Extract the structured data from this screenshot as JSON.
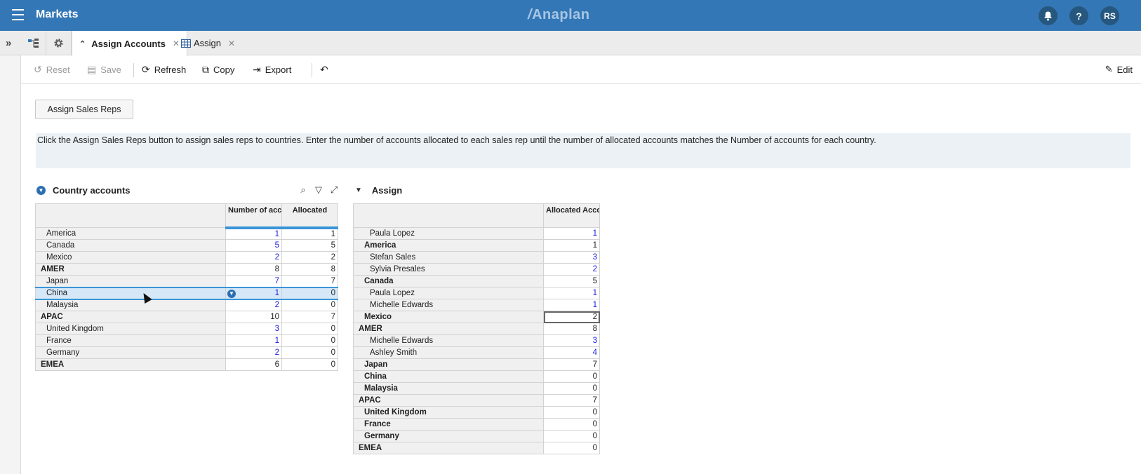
{
  "header": {
    "app_title": "Markets",
    "brand": "Anaplan",
    "notifications_icon": "bell-icon",
    "help_label": "?",
    "avatar_initials": "RS",
    "colors": {
      "bar": "#3477b6",
      "icon_bg": "#26577f",
      "accent": "#3a94d8",
      "input_blue": "#1a1ae0"
    }
  },
  "tabs": [
    {
      "label": "Assign Accounts",
      "active": true
    },
    {
      "label": "Assign",
      "active": false
    }
  ],
  "toolbar": {
    "reset": "Reset",
    "save": "Save",
    "refresh": "Refresh",
    "copy": "Copy",
    "export": "Export",
    "edit": "Edit"
  },
  "action_button": "Assign Sales Reps",
  "info_text": "Click the Assign Sales Reps button to assign sales reps to countries. Enter the number of accounts allocated to each sales rep until the number of allocated accounts matches the Number of accounts for each country.",
  "country_panel": {
    "title": "Country accounts",
    "columns": [
      "Number of accounts",
      "Allocated"
    ],
    "rows": [
      {
        "label": "America",
        "level": "item",
        "accounts": "1",
        "allocated": "1",
        "input": true
      },
      {
        "label": "Canada",
        "level": "item",
        "accounts": "5",
        "allocated": "5",
        "input": true
      },
      {
        "label": "Mexico",
        "level": "item",
        "accounts": "2",
        "allocated": "2",
        "input": true
      },
      {
        "label": "AMER",
        "level": "total",
        "accounts": "8",
        "allocated": "8",
        "input": false
      },
      {
        "label": "Japan",
        "level": "item",
        "accounts": "7",
        "allocated": "7",
        "input": true
      },
      {
        "label": "China",
        "level": "item",
        "accounts": "1",
        "allocated": "0",
        "input": true,
        "selected": true
      },
      {
        "label": "Malaysia",
        "level": "item",
        "accounts": "2",
        "allocated": "0",
        "input": true
      },
      {
        "label": "APAC",
        "level": "total",
        "accounts": "10",
        "allocated": "7",
        "input": false
      },
      {
        "label": "United Kingdom",
        "level": "item",
        "accounts": "3",
        "allocated": "0",
        "input": true
      },
      {
        "label": "France",
        "level": "item",
        "accounts": "1",
        "allocated": "0",
        "input": true
      },
      {
        "label": "Germany",
        "level": "item",
        "accounts": "2",
        "allocated": "0",
        "input": true
      },
      {
        "label": "EMEA",
        "level": "total",
        "accounts": "6",
        "allocated": "0",
        "input": false
      }
    ]
  },
  "assign_panel": {
    "title": "Assign",
    "columns": [
      "Allocated Accounts"
    ],
    "rows": [
      {
        "label": "Paula Lopez",
        "level": "item",
        "value": "1",
        "input": true
      },
      {
        "label": "America",
        "level": "sub",
        "value": "1",
        "input": false
      },
      {
        "label": "Stefan Sales",
        "level": "item",
        "value": "3",
        "input": true
      },
      {
        "label": "Sylvia Presales",
        "level": "item",
        "value": "2",
        "input": true
      },
      {
        "label": "Canada",
        "level": "sub",
        "value": "5",
        "input": false
      },
      {
        "label": "Paula Lopez",
        "level": "item",
        "value": "1",
        "input": true
      },
      {
        "label": "Michelle Edwards",
        "level": "item",
        "value": "1",
        "input": true
      },
      {
        "label": "Mexico",
        "level": "sub",
        "value": "2",
        "input": false,
        "editing": true
      },
      {
        "label": "AMER",
        "level": "total",
        "value": "8",
        "input": false
      },
      {
        "label": "Michelle Edwards",
        "level": "item",
        "value": "3",
        "input": true
      },
      {
        "label": "Ashley Smith",
        "level": "item",
        "value": "4",
        "input": true
      },
      {
        "label": "Japan",
        "level": "sub",
        "value": "7",
        "input": false
      },
      {
        "label": "China",
        "level": "sub",
        "value": "0",
        "input": false
      },
      {
        "label": "Malaysia",
        "level": "sub",
        "value": "0",
        "input": false
      },
      {
        "label": "APAC",
        "level": "total",
        "value": "7",
        "input": false
      },
      {
        "label": "United Kingdom",
        "level": "sub",
        "value": "0",
        "input": false
      },
      {
        "label": "France",
        "level": "sub",
        "value": "0",
        "input": false
      },
      {
        "label": "Germany",
        "level": "sub",
        "value": "0",
        "input": false
      },
      {
        "label": "EMEA",
        "level": "total",
        "value": "0",
        "input": false
      }
    ]
  }
}
